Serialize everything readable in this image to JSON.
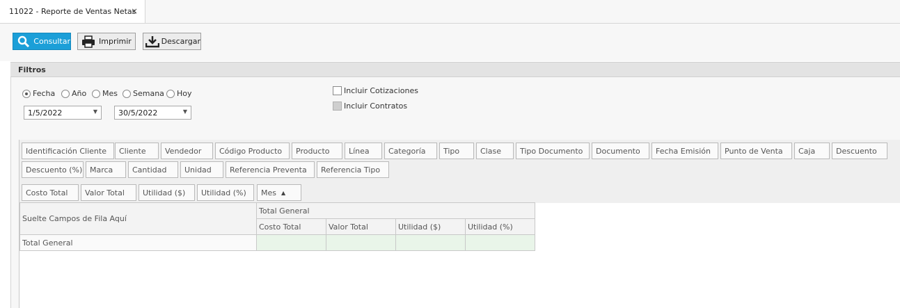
{
  "tab": {
    "title": "11022 - Reporte de Ventas Netas",
    "close": "×"
  },
  "toolbar": {
    "consultar": "Consultar",
    "imprimir": "Imprimir",
    "descargar": "Descargar"
  },
  "filters": {
    "title": "Filtros",
    "period_options": [
      "Fecha",
      "Año",
      "Mes",
      "Semana",
      "Hoy"
    ],
    "selected_period": "Fecha",
    "date_from": "1/5/2022",
    "date_to": "30/5/2022",
    "include_quotes": "Incluir Cotizaciones",
    "include_contracts": "Incluir Contratos"
  },
  "pivot": {
    "available_fields_row1": [
      "Identificación Cliente",
      "Cliente",
      "Vendedor",
      "Código Producto",
      "Producto",
      "Línea",
      "Categoría",
      "Tipo",
      "Clase",
      "Tipo Documento",
      "Documento",
      "Fecha Emisión",
      "Punto de Venta",
      "Caja",
      "Descuento"
    ],
    "available_fields_row2": [
      "Descuento (%)",
      "Marca",
      "Cantidad",
      "Unidad",
      "Referencia Preventa",
      "Referencia Tipo"
    ],
    "data_fields": [
      "Costo Total",
      "Valor Total",
      "Utilidad ($)",
      "Utilidad (%)"
    ],
    "column_field": "Mes",
    "row_drop_hint": "Suelte Campos de Fila Aquí",
    "column_total": "Total General",
    "value_headers": [
      "Costo Total",
      "Valor Total",
      "Utilidad ($)",
      "Utilidad (%)"
    ],
    "row_total": "Total General"
  },
  "colors": {
    "accent": "#1b9fd8",
    "data_cell": "#e9f5e9"
  }
}
